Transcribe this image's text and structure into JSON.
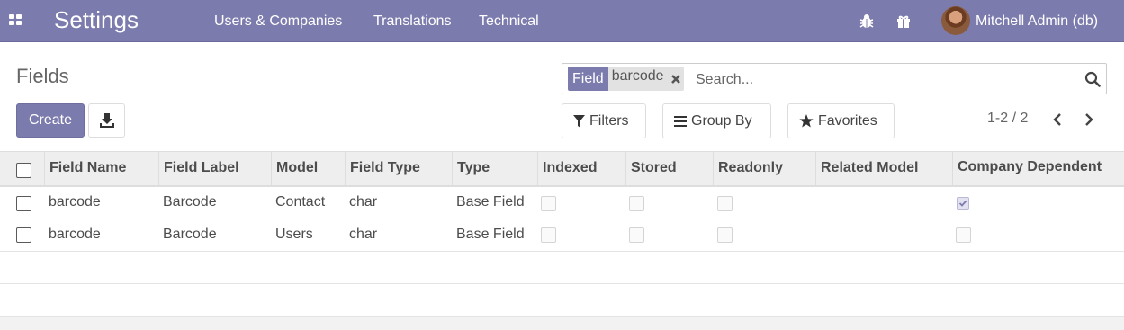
{
  "navbar": {
    "app_title": "Settings",
    "menu": [
      "Users & Companies",
      "Translations",
      "Technical"
    ],
    "icons": [
      "apps-grid-icon",
      "bug-icon",
      "gift-icon"
    ],
    "user_name": "Mitchell Admin (db)"
  },
  "control_panel": {
    "title": "Fields",
    "create_label": "Create",
    "search": {
      "facet_label": "Field",
      "facet_value": "barcode",
      "placeholder": "Search..."
    },
    "filters_label": "Filters",
    "groupby_label": "Group By",
    "favorites_label": "Favorites",
    "pager": "1-2 / 2"
  },
  "table": {
    "headers": [
      "Field Name",
      "Field Label",
      "Model",
      "Field Type",
      "Type",
      "Indexed",
      "Stored",
      "Readonly",
      "Related Model",
      "Company Dependent"
    ],
    "rows": [
      {
        "field_name": "barcode",
        "field_label": "Barcode",
        "model": "Contact",
        "field_type": "char",
        "type": "Base Field",
        "indexed": false,
        "stored": false,
        "readonly": false,
        "related_model": "",
        "company_dependent": true
      },
      {
        "field_name": "barcode",
        "field_label": "Barcode",
        "model": "Users",
        "field_type": "char",
        "type": "Base Field",
        "indexed": false,
        "stored": false,
        "readonly": false,
        "related_model": "",
        "company_dependent": false
      }
    ]
  },
  "colors": {
    "brand": "#7c7bad",
    "header_bg": "#eeeeee"
  }
}
